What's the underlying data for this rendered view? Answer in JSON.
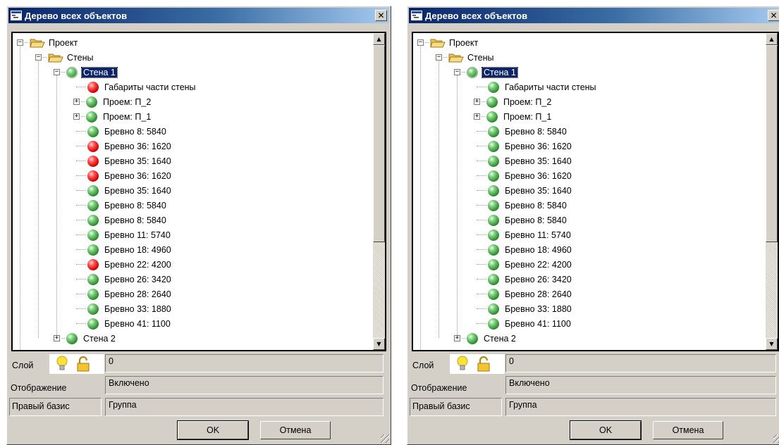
{
  "windows": [
    {
      "title": "Дерево всех объектов",
      "tree": [
        {
          "label": "Проект",
          "icon": "folder",
          "level": 0,
          "toggle": "minus"
        },
        {
          "label": "Стены",
          "icon": "folder",
          "level": 1,
          "toggle": "minus"
        },
        {
          "label": "Стена 1",
          "icon": "ring",
          "level": 2,
          "toggle": "minus",
          "selected": true
        },
        {
          "label": "Габариты части стены",
          "icon": "red",
          "level": 3
        },
        {
          "label": "Проем: П_2",
          "icon": "green",
          "level": 3,
          "toggle": "plus"
        },
        {
          "label": "Проем: П_1",
          "icon": "green",
          "level": 3,
          "toggle": "plus"
        },
        {
          "label": "Бревно 8: 5840",
          "icon": "green",
          "level": 3
        },
        {
          "label": "Бревно 36: 1620",
          "icon": "red",
          "level": 3
        },
        {
          "label": "Бревно 35: 1640",
          "icon": "red",
          "level": 3
        },
        {
          "label": "Бревно 36: 1620",
          "icon": "red",
          "level": 3
        },
        {
          "label": "Бревно 35: 1640",
          "icon": "green",
          "level": 3
        },
        {
          "label": "Бревно 8: 5840",
          "icon": "green",
          "level": 3
        },
        {
          "label": "Бревно 8: 5840",
          "icon": "green",
          "level": 3
        },
        {
          "label": "Бревно 11: 5740",
          "icon": "green",
          "level": 3
        },
        {
          "label": "Бревно 18: 4960",
          "icon": "green",
          "level": 3
        },
        {
          "label": "Бревно 22: 4200",
          "icon": "red",
          "level": 3
        },
        {
          "label": "Бревно 26: 3420",
          "icon": "green",
          "level": 3
        },
        {
          "label": "Бревно 28: 2640",
          "icon": "green",
          "level": 3
        },
        {
          "label": "Бревно 33: 1880",
          "icon": "green",
          "level": 3
        },
        {
          "label": "Бревно 41: 1100",
          "icon": "green",
          "level": 3
        },
        {
          "label": "Стена 2",
          "icon": "green",
          "level": 2,
          "toggle": "plus"
        }
      ],
      "props": {
        "layer_label": "Слой",
        "layer_value": "0",
        "display_label": "Отображение",
        "display_value": "Включено",
        "basis_label": "Правый базис",
        "basis_value": "Группа"
      },
      "ok_label": "OK",
      "cancel_label": "Отмена"
    },
    {
      "title": "Дерево всех объектов",
      "tree": [
        {
          "label": "Проект",
          "icon": "folder",
          "level": 0,
          "toggle": "minus"
        },
        {
          "label": "Стены",
          "icon": "folder",
          "level": 1,
          "toggle": "minus"
        },
        {
          "label": "Стена 1",
          "icon": "ring",
          "level": 2,
          "toggle": "minus",
          "selected": true
        },
        {
          "label": "Габариты части стены",
          "icon": "green",
          "level": 3
        },
        {
          "label": "Проем: П_2",
          "icon": "green",
          "level": 3,
          "toggle": "plus"
        },
        {
          "label": "Проем: П_1",
          "icon": "green",
          "level": 3,
          "toggle": "plus"
        },
        {
          "label": "Бревно 8: 5840",
          "icon": "green",
          "level": 3
        },
        {
          "label": "Бревно 36: 1620",
          "icon": "green",
          "level": 3
        },
        {
          "label": "Бревно 35: 1640",
          "icon": "green",
          "level": 3
        },
        {
          "label": "Бревно 36: 1620",
          "icon": "green",
          "level": 3
        },
        {
          "label": "Бревно 35: 1640",
          "icon": "green",
          "level": 3
        },
        {
          "label": "Бревно 8: 5840",
          "icon": "green",
          "level": 3
        },
        {
          "label": "Бревно 8: 5840",
          "icon": "green",
          "level": 3
        },
        {
          "label": "Бревно 11: 5740",
          "icon": "green",
          "level": 3
        },
        {
          "label": "Бревно 18: 4960",
          "icon": "green",
          "level": 3
        },
        {
          "label": "Бревно 22: 4200",
          "icon": "green",
          "level": 3
        },
        {
          "label": "Бревно 26: 3420",
          "icon": "green",
          "level": 3
        },
        {
          "label": "Бревно 28: 2640",
          "icon": "green",
          "level": 3
        },
        {
          "label": "Бревно 33: 1880",
          "icon": "green",
          "level": 3
        },
        {
          "label": "Бревно 41: 1100",
          "icon": "green",
          "level": 3
        },
        {
          "label": "Стена 2",
          "icon": "green",
          "level": 2,
          "toggle": "plus"
        }
      ],
      "props": {
        "layer_label": "Слой",
        "layer_value": "0",
        "display_label": "Отображение",
        "display_value": "Включено",
        "basis_label": "Правый базис",
        "basis_value": "Группа"
      },
      "ok_label": "OK",
      "cancel_label": "Отмена"
    }
  ],
  "colors": {
    "title_start": "#0a246a",
    "title_end": "#a6caf0",
    "status_ok": "#2e8b2e",
    "status_error": "#d10000",
    "selection": "#0a246a",
    "dialog_bg": "#d4d0c8"
  },
  "icons": {
    "title": "tree-window-icon",
    "close": "close-icon",
    "folder": "open-folder-icon",
    "bulb": "lightbulb-icon",
    "lock": "padlock-icon",
    "scroll_up": "arrow-up-icon",
    "scroll_down": "arrow-down-icon"
  }
}
